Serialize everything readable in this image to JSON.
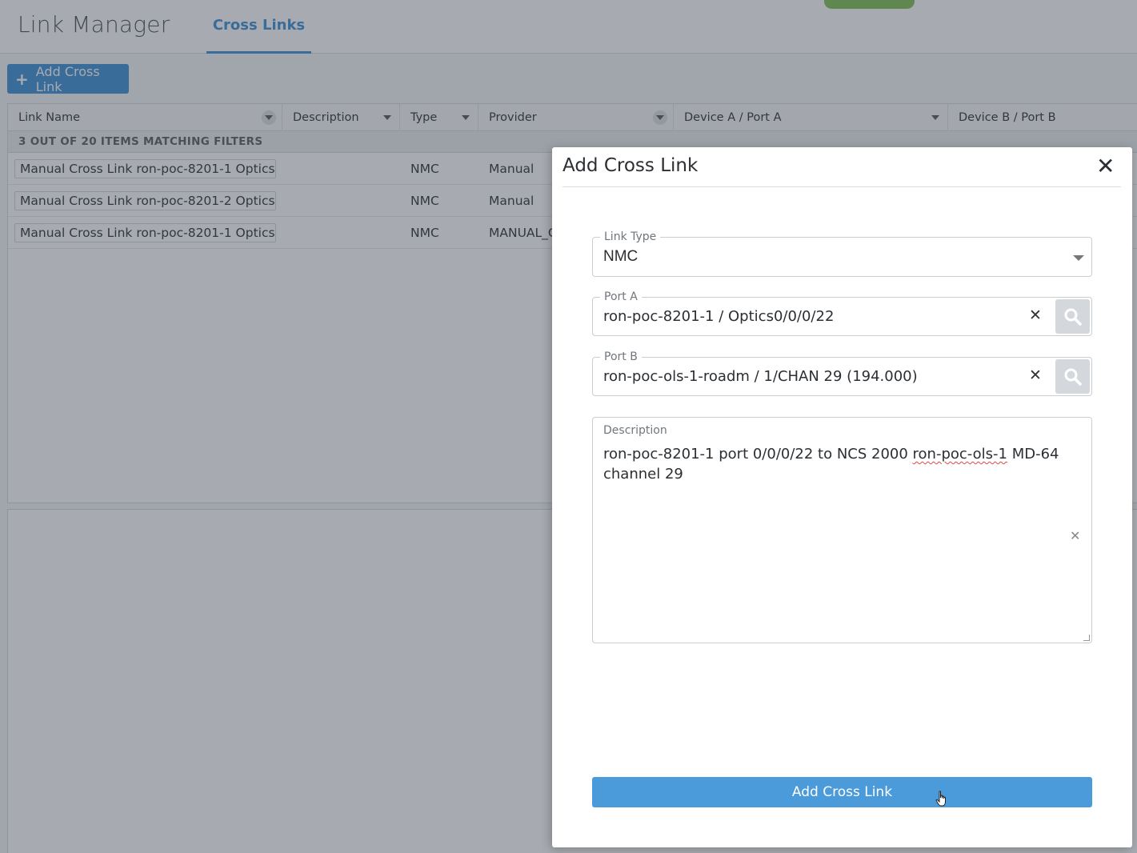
{
  "header": {
    "app_title": "Link Manager",
    "active_tab": "Cross Links"
  },
  "toolbar": {
    "add_label": "Add Cross Link"
  },
  "table": {
    "columns": [
      "Link Name",
      "Description",
      "Type",
      "Provider",
      "Device A / Port A",
      "Device B / Port B"
    ],
    "filter_banner": "3 OUT OF 20 ITEMS MATCHING FILTERS",
    "rows": [
      {
        "name": "Manual Cross Link ron-poc-8201-1 Optics…",
        "description": "",
        "type": "NMC",
        "provider": "Manual"
      },
      {
        "name": "Manual Cross Link ron-poc-8201-2 Optics…",
        "description": "",
        "type": "NMC",
        "provider": "Manual"
      },
      {
        "name": "Manual Cross Link ron-poc-8201-1 Optics…",
        "description": "",
        "type": "NMC",
        "provider": "MANUAL_C"
      }
    ]
  },
  "modal": {
    "title": "Add Cross Link",
    "link_type": {
      "label": "Link Type",
      "value": "NMC"
    },
    "port_a": {
      "label": "Port A",
      "value": "ron-poc-8201-1 / Optics0/0/0/22"
    },
    "port_b": {
      "label": "Port B",
      "value": "ron-poc-ols-1-roadm / 1/CHAN 29 (194.000)"
    },
    "description": {
      "label": "Description",
      "text_before": "ron-poc-8201-1 port 0/0/0/22 to NCS 2000 ",
      "text_flagged": "ron-poc-ols-1",
      "text_after": " MD-64 channel 29"
    },
    "submit_label": "Add Cross Link"
  },
  "colors": {
    "accent": "#3a8fd6",
    "submit": "#4b9ad9",
    "overlay": "rgba(60,66,80,0.45)"
  }
}
